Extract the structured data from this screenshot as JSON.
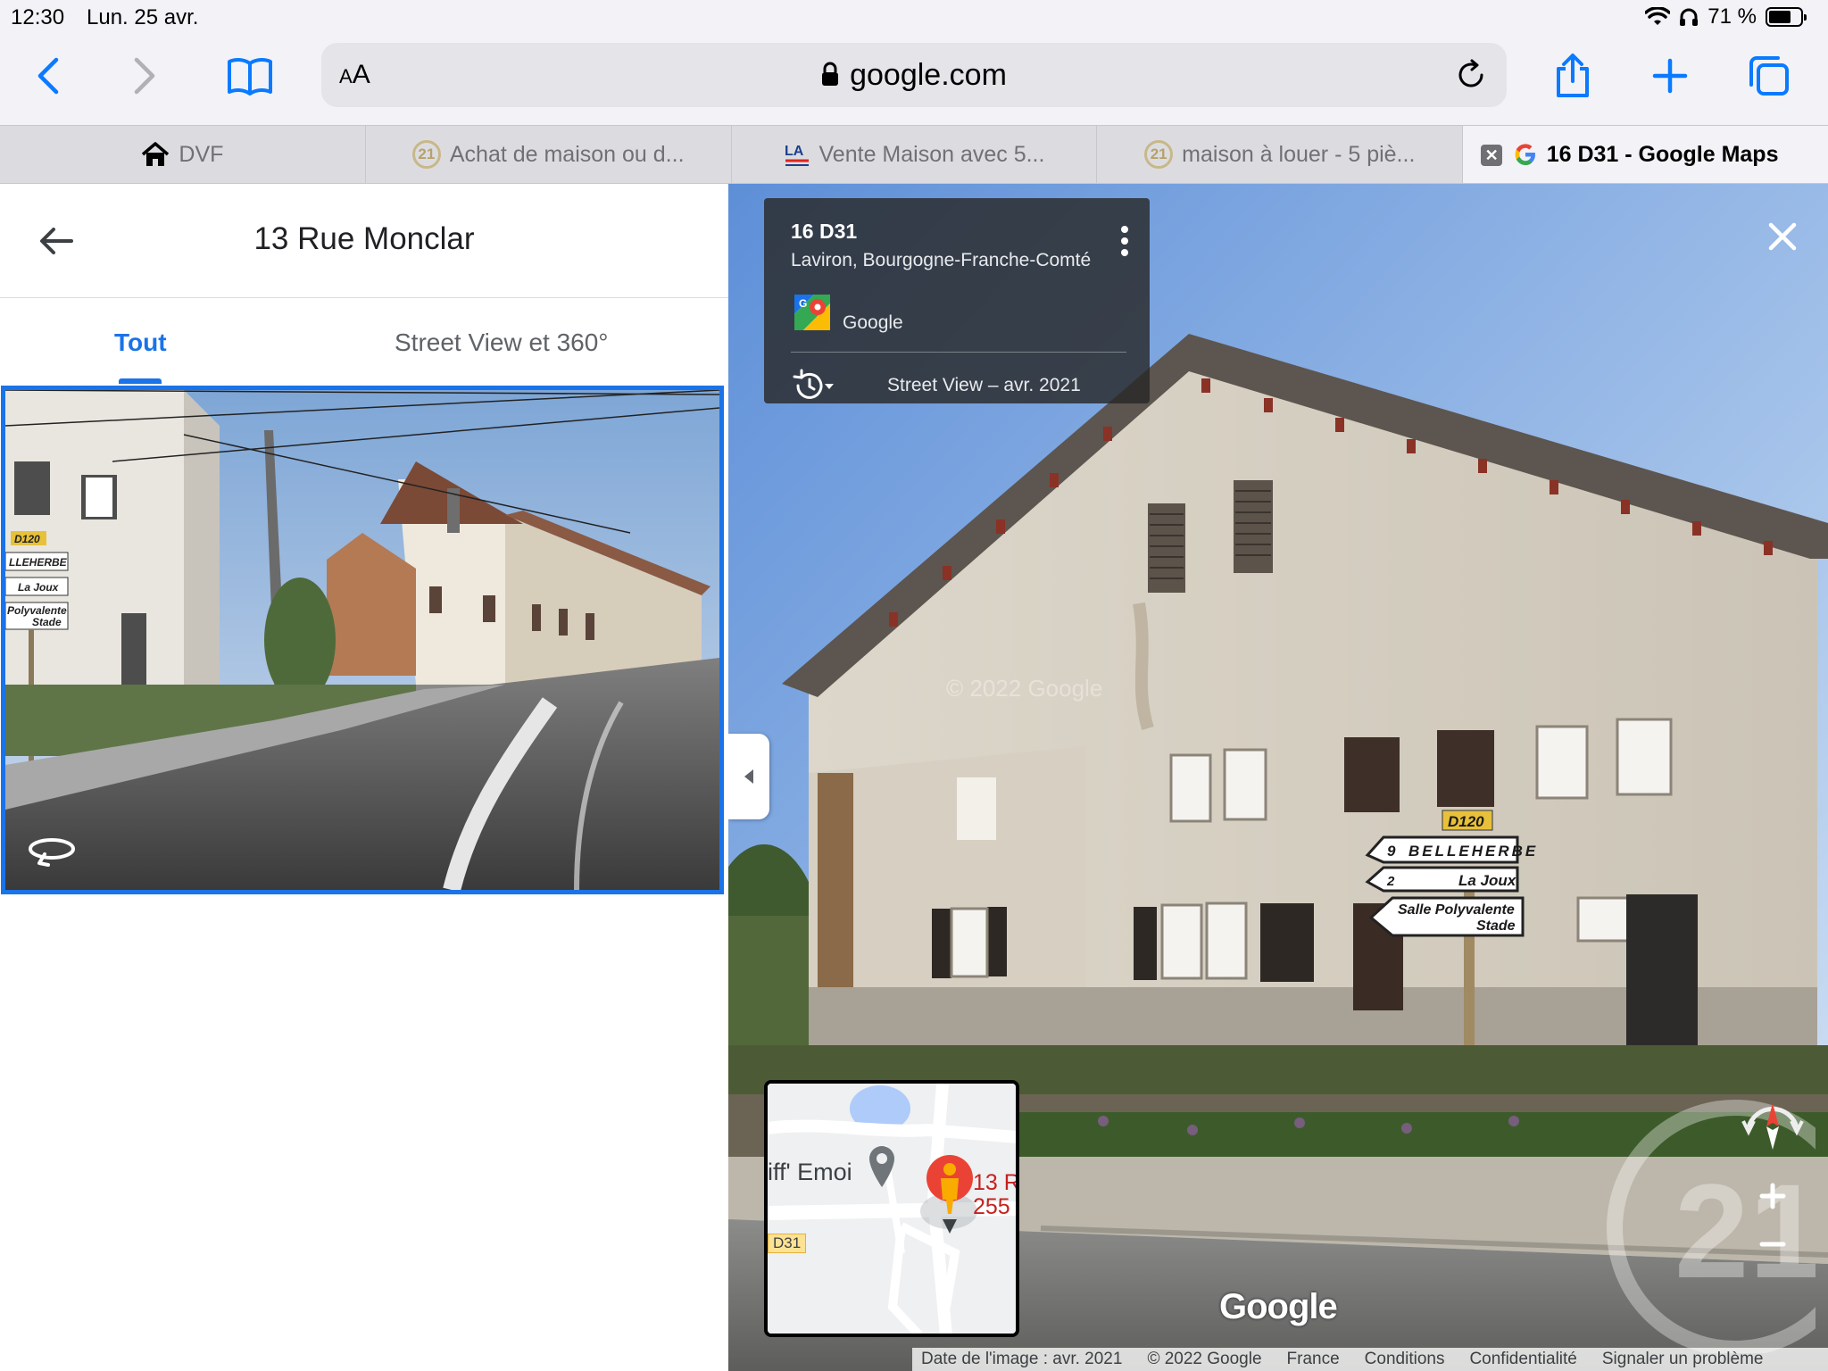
{
  "status_bar": {
    "time": "12:30",
    "date": "Lun. 25 avr.",
    "battery": "71 %",
    "battery_level": 0.71
  },
  "toolbar": {
    "text_size_label": "AA",
    "url": "google.com"
  },
  "tabs": [
    {
      "label": "DVF",
      "icon": "home-icon"
    },
    {
      "label": "Achat de maison ou d...",
      "icon": "century21-icon"
    },
    {
      "label": "Vente Maison avec 5...",
      "icon": "laforet-icon"
    },
    {
      "label": "maison à louer - 5 piè...",
      "icon": "century21-icon"
    },
    {
      "label": "16 D31 - Google Maps",
      "icon": "google-icon",
      "active": true
    }
  ],
  "left_panel": {
    "title": "13 Rue Monclar",
    "tabs": [
      {
        "label": "Tout",
        "active": true
      },
      {
        "label": "Street View et 360°",
        "active": false
      }
    ],
    "thumb_sign_labels": [
      "D120",
      "LLEHERBE",
      "La Joux",
      "Polyvalente",
      "Stade"
    ]
  },
  "street_view": {
    "info_card": {
      "title": "16 D31",
      "subtitle": "Laviron, Bourgogne-Franche-Comté",
      "contributor": "Google",
      "date": "Street View – avr. 2021"
    },
    "scene_labels": {
      "watermark": "© 2022 Google",
      "road_sign_route": "D120",
      "sign1_number": "9",
      "sign1_text": "BELLEHERBE",
      "sign2_number": "2",
      "sign2_text": "La Joux",
      "sign3_line1": "Salle Polyvalente",
      "sign3_line2": "Stade"
    },
    "minimap": {
      "place_label": "iff' Emoi",
      "address_label": "13 R\n255",
      "road_label": "D31"
    },
    "google_logo": "Google",
    "attribution": [
      "Date de l'image : avr. 2021",
      "© 2022 Google",
      "France",
      "Conditions",
      "Confidentialité",
      "Signaler un problème"
    ]
  },
  "colors": {
    "accent": "#1a73e8",
    "safari_blue": "#0a7aff",
    "pegman": "#f9ab00",
    "pin": "#ea4335"
  }
}
